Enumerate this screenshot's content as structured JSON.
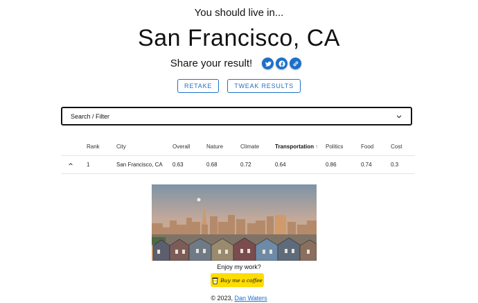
{
  "header": {
    "intro": "You should live in...",
    "city": "San Francisco, CA"
  },
  "share": {
    "label": "Share your result!",
    "icons": [
      "twitter-icon",
      "facebook-icon",
      "link-icon"
    ],
    "accent": "#1d6fc9"
  },
  "actions": {
    "retake": "RETAKE",
    "tweak": "TWEAK RESULTS"
  },
  "filter": {
    "label": "Search / Filter"
  },
  "table": {
    "headers": [
      "Rank",
      "City",
      "Overall",
      "Nature",
      "Climate",
      "Transportation",
      "Politics",
      "Food",
      "Cost"
    ],
    "sorted_column": "Transportation",
    "rows": [
      {
        "rank": "1",
        "city": "San Francisco, CA",
        "overall": "0.63",
        "nature": "0.68",
        "climate": "0.72",
        "transportation": "0.64",
        "politics": "0.86",
        "food": "0.74",
        "cost": "0.3"
      }
    ]
  },
  "support": {
    "prompt": "Enjoy my work?",
    "coffee": "Buy me a coffee",
    "coffee_color": "#ffdd00"
  },
  "footer": {
    "copyright": "© 2023,",
    "author": "Dan Waters"
  }
}
